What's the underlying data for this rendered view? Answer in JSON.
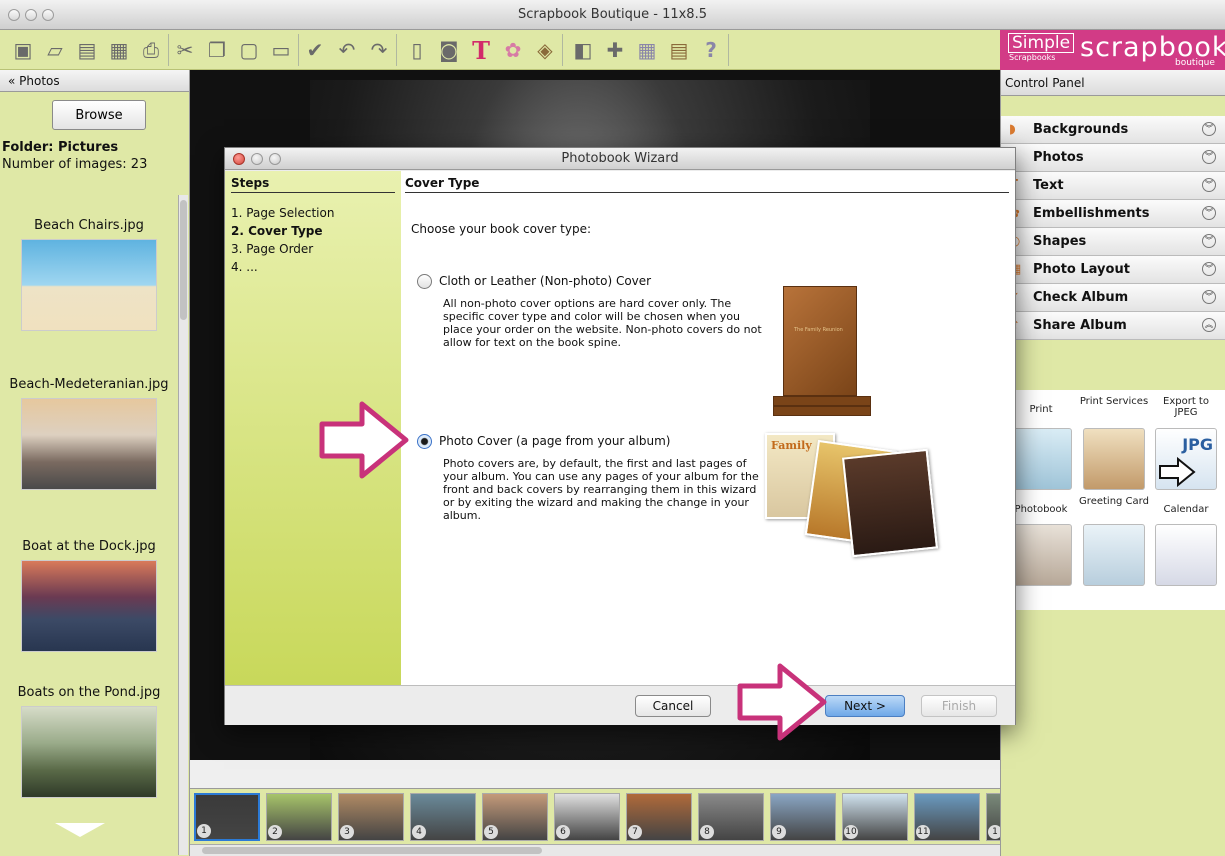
{
  "window": {
    "title": "Scrapbook Boutique - 11x8.5"
  },
  "brand": {
    "simple": "Simple",
    "simple_sub": "Scrapbooks",
    "scrapbook": "scrapbook",
    "boutique": "boutique"
  },
  "left": {
    "header": "« Photos",
    "browse_label": "Browse",
    "folder": "Folder: Pictures",
    "count": "Number of images: 23",
    "thumbs": [
      {
        "name": "Beach Chairs.jpg"
      },
      {
        "name": "Beach-Medeteranian.jpg"
      },
      {
        "name": "Boat at the Dock.jpg"
      },
      {
        "name": "Boats on the Pond.jpg"
      }
    ]
  },
  "filmstrip": {
    "numbers": [
      "1",
      "2",
      "3",
      "4",
      "5",
      "6",
      "7",
      "8",
      "9",
      "10",
      "11",
      "1"
    ]
  },
  "right": {
    "header": "Control Panel",
    "items": [
      {
        "label": "Backgrounds",
        "icon": "backgrounds-icon",
        "glyph": "◗"
      },
      {
        "label": "Photos",
        "icon": "photos-icon",
        "glyph": "◗"
      },
      {
        "label": "Text",
        "icon": "text-icon",
        "glyph": "T"
      },
      {
        "label": "Embellishments",
        "icon": "embellishments-icon",
        "glyph": "✿"
      },
      {
        "label": "Shapes",
        "icon": "shapes-icon",
        "glyph": "◐"
      },
      {
        "label": "Photo Layout",
        "icon": "photo-layout-icon",
        "glyph": "▦"
      },
      {
        "label": "Check Album",
        "icon": "check-album-icon",
        "glyph": "✓"
      },
      {
        "label": "Share Album",
        "icon": "share-album-icon",
        "glyph": "⇪"
      }
    ],
    "share": [
      {
        "label": "Print"
      },
      {
        "label": "Print Services"
      },
      {
        "label": "Export to JPEG"
      },
      {
        "label": "Photobook"
      },
      {
        "label": "Greeting Card"
      },
      {
        "label": "Calendar"
      }
    ],
    "jpg_badge": "JPG"
  },
  "dialog": {
    "title": "Photobook Wizard",
    "steps_header": "Steps",
    "steps": [
      "1. Page Selection",
      "2. Cover Type",
      "3. Page Order",
      "4. ..."
    ],
    "current_step": 1,
    "section_header": "Cover Type",
    "prompt": "Choose your book cover type:",
    "option1": {
      "label": "Cloth or Leather (Non-photo) Cover",
      "desc": "All non-photo cover options are hard cover only. The specific cover type and color will be chosen when you place your order on the website. Non-photo covers do not allow for text on the book spine.",
      "selected": false,
      "book_text": "The Family Reunion"
    },
    "option2": {
      "label": "Photo Cover (a page from your album)",
      "desc": "Photo covers are, by default, the first and last pages of your album. You can use any pages of your album for the front and back covers by rearranging them in this wizard or by exiting the wizard and making the change in your album.",
      "selected": true,
      "family_text": "Family"
    },
    "buttons": {
      "cancel": "Cancel",
      "next": "Next >",
      "finish": "Finish"
    }
  },
  "colors": {
    "panel_green": "#dfe8a6",
    "brand_pink": "#d23b86",
    "arrow_pink": "#c8327a",
    "primary_blue": "#6fa8e8"
  }
}
